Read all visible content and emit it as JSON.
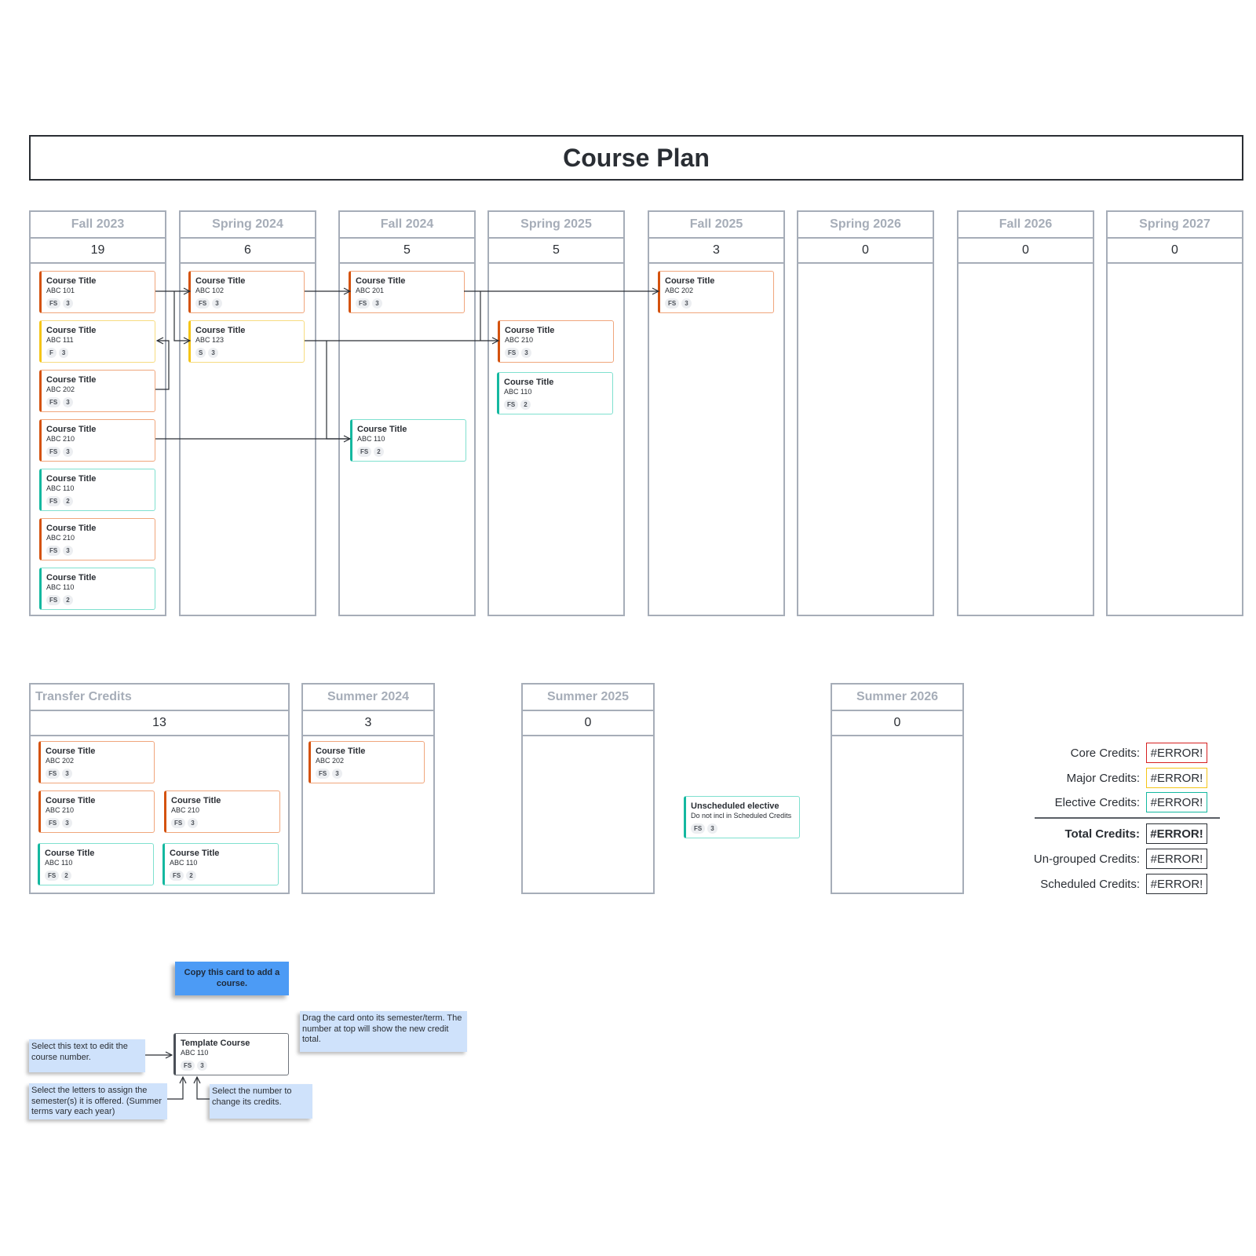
{
  "title": "Course Plan",
  "semesters": [
    {
      "name": "Fall 2023",
      "credits": "19",
      "courses": [
        {
          "title": "Course Title",
          "code": "ABC 101",
          "terms": "FS",
          "credits": "3",
          "type": "core"
        },
        {
          "title": "Course Title",
          "code": "ABC 111",
          "terms": "F",
          "credits": "3",
          "type": "major"
        },
        {
          "title": "Course Title",
          "code": "ABC 202",
          "terms": "FS",
          "credits": "3",
          "type": "core"
        },
        {
          "title": "Course Title",
          "code": "ABC 210",
          "terms": "FS",
          "credits": "3",
          "type": "core"
        },
        {
          "title": "Course Title",
          "code": "ABC 110",
          "terms": "FS",
          "credits": "2",
          "type": "elective"
        },
        {
          "title": "Course Title",
          "code": "ABC 210",
          "terms": "FS",
          "credits": "3",
          "type": "core"
        },
        {
          "title": "Course Title",
          "code": "ABC 110",
          "terms": "FS",
          "credits": "2",
          "type": "elective"
        }
      ]
    },
    {
      "name": "Spring 2024",
      "credits": "6",
      "courses": [
        {
          "title": "Course Title",
          "code": "ABC 102",
          "terms": "FS",
          "credits": "3",
          "type": "core"
        },
        {
          "title": "Course Title",
          "code": "ABC 123",
          "terms": "S",
          "credits": "3",
          "type": "major"
        }
      ]
    },
    {
      "name": "Fall 2024",
      "credits": "5",
      "courses": [
        {
          "title": "Course Title",
          "code": "ABC 201",
          "terms": "FS",
          "credits": "3",
          "type": "core"
        },
        {
          "title": "Course Title",
          "code": "ABC 110",
          "terms": "FS",
          "credits": "2",
          "type": "elective"
        }
      ]
    },
    {
      "name": "Spring 2025",
      "credits": "5",
      "courses": [
        {
          "title": "Course Title",
          "code": "ABC 210",
          "terms": "FS",
          "credits": "3",
          "type": "core"
        },
        {
          "title": "Course Title",
          "code": "ABC 110",
          "terms": "FS",
          "credits": "2",
          "type": "elective"
        }
      ]
    },
    {
      "name": "Fall 2025",
      "credits": "3",
      "courses": [
        {
          "title": "Course Title",
          "code": "ABC 202",
          "terms": "FS",
          "credits": "3",
          "type": "core"
        }
      ]
    },
    {
      "name": "Spring 2026",
      "credits": "0",
      "courses": []
    },
    {
      "name": "Fall 2026",
      "credits": "0",
      "courses": []
    },
    {
      "name": "Spring 2027",
      "credits": "0",
      "courses": []
    }
  ],
  "transfer": {
    "name": "Transfer Credits",
    "credits": "13",
    "courses": [
      {
        "title": "Course Title",
        "code": "ABC 202",
        "terms": "FS",
        "credits": "3",
        "type": "core"
      },
      {
        "title": "Course Title",
        "code": "ABC 210",
        "terms": "FS",
        "credits": "3",
        "type": "core"
      },
      {
        "title": "Course Title",
        "code": "ABC 210",
        "terms": "FS",
        "credits": "3",
        "type": "core"
      },
      {
        "title": "Course Title",
        "code": "ABC 110",
        "terms": "FS",
        "credits": "2",
        "type": "elective"
      },
      {
        "title": "Course Title",
        "code": "ABC 110",
        "terms": "FS",
        "credits": "2",
        "type": "elective"
      }
    ]
  },
  "summers": [
    {
      "name": "Summer 2024",
      "credits": "3",
      "courses": [
        {
          "title": "Course Title",
          "code": "ABC 202",
          "terms": "FS",
          "credits": "3",
          "type": "core"
        }
      ]
    },
    {
      "name": "Summer 2025",
      "credits": "0",
      "courses": []
    },
    {
      "name": "Summer 2026",
      "credits": "0",
      "courses": []
    }
  ],
  "unscheduled": {
    "title": "Unscheduled elective",
    "code": "Do not incl in Scheduled Credits",
    "terms": "FS",
    "credits": "3",
    "type": "elective"
  },
  "summary": [
    {
      "label": "Core Credits:",
      "value": "#ERROR!",
      "style": "core"
    },
    {
      "label": "Major Credits:",
      "value": "#ERROR!",
      "style": "major"
    },
    {
      "label": "Elective Credits:",
      "value": "#ERROR!",
      "style": "elective"
    },
    {
      "label": "Total Credits:",
      "value": "#ERROR!",
      "style": "bold"
    },
    {
      "label": "Un-grouped Credits:",
      "value": "#ERROR!",
      "style": ""
    },
    {
      "label": "Scheduled Credits:",
      "value": "#ERROR!",
      "style": ""
    }
  ],
  "instructions": {
    "copy_card": "Copy this card to add a course.",
    "template_card": {
      "title": "Template Course",
      "code": "ABC 110",
      "terms": "FS",
      "credits": "3"
    },
    "drag_note": "Drag the card onto its semester/term. The number at top will show the new credit total.",
    "edit_note": "Select this text to edit the course number.",
    "letters_note": "Select the letters to assign the semester(s) it is offered. (Summer terms vary each year)",
    "number_note": "Select the number to change its credits."
  }
}
